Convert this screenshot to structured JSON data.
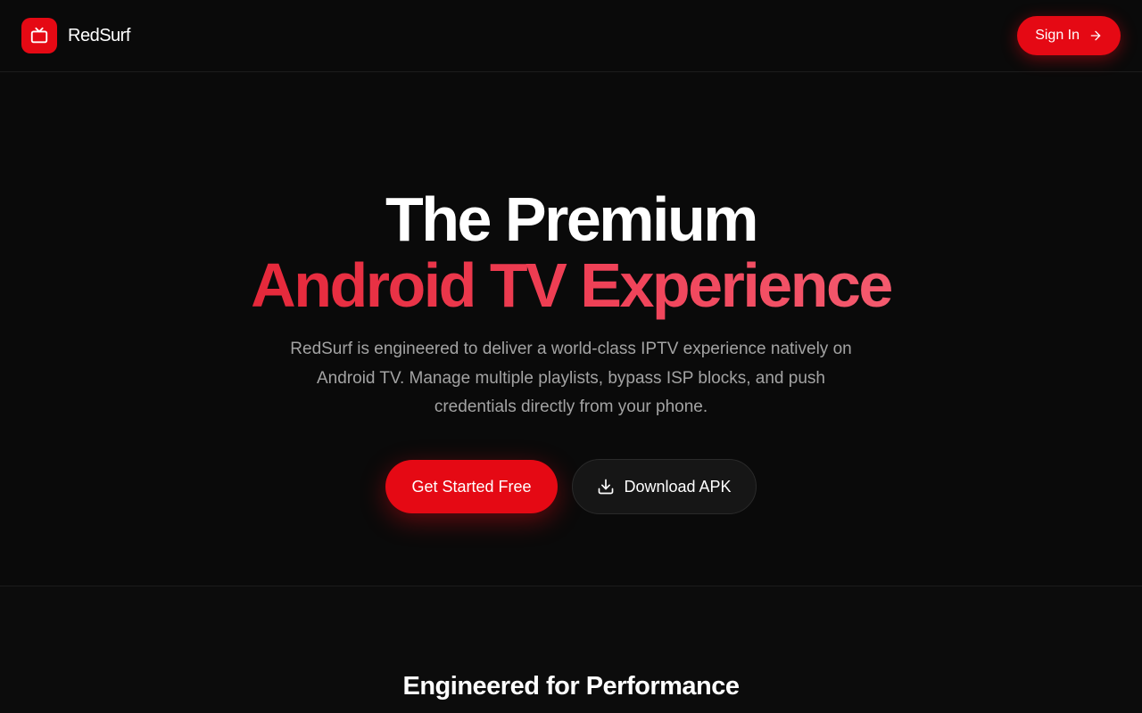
{
  "header": {
    "brand_name": "RedSurf",
    "logo_icon": "tv-icon",
    "sign_in_label": "Sign In",
    "sign_in_icon": "arrow-right-icon"
  },
  "hero": {
    "title_line1": "The Premium",
    "title_line2": "Android TV Experience",
    "subtitle": "RedSurf is engineered to deliver a world-class IPTV experience natively on Android TV. Manage multiple playlists, bypass ISP blocks, and push credentials directly from your phone.",
    "primary_cta": "Get Started Free",
    "secondary_cta": "Download APK",
    "secondary_cta_icon": "download-icon"
  },
  "features": {
    "title": "Engineered for Performance"
  },
  "colors": {
    "background": "#0a0a0a",
    "accent": "#e50914",
    "gradient_start": "#e5283a",
    "gradient_end": "#f45a6e",
    "muted_text": "#a3a3a3"
  }
}
